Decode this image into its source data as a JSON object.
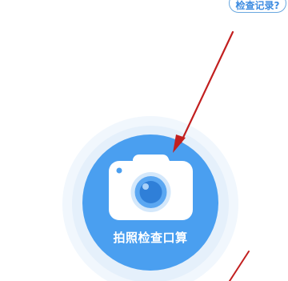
{
  "header": {
    "history_link_label": "检查记录?"
  },
  "main": {
    "scan_button_label": "拍照检查口算",
    "accent_color": "#4a9ff0",
    "annotation_color": "#c21f1f"
  },
  "icons": {
    "scan_button": "camera-icon"
  }
}
